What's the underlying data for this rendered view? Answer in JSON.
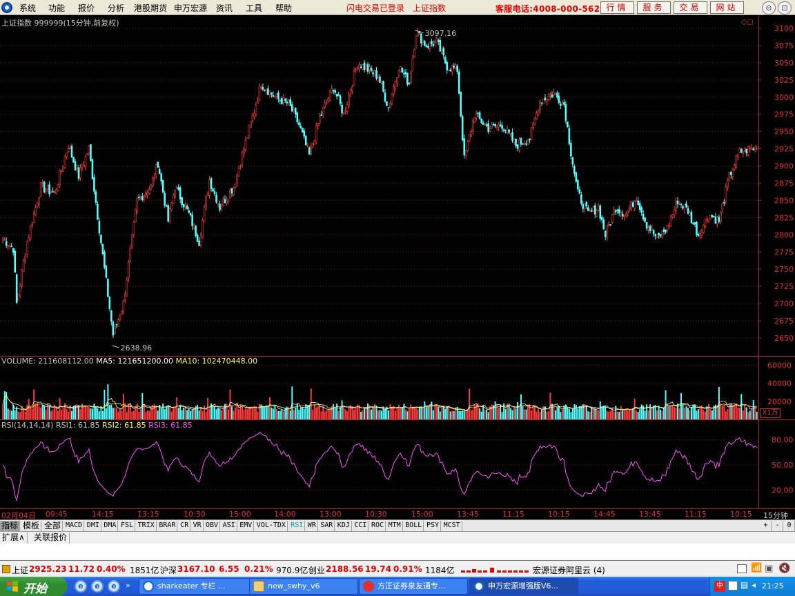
{
  "menu": [
    "系统",
    "功能",
    "报价",
    "分析",
    "港股期货",
    "申万宏源",
    "资讯",
    "工具",
    "帮助"
  ],
  "red_links": [
    "闪电交易已登录",
    "上证指数"
  ],
  "hotline": "客服电话:4008-000-562",
  "top_buttons": [
    "行情",
    "服务",
    "交易",
    "网站"
  ],
  "window_buttons": [
    "⊝",
    "⊡",
    "✕"
  ],
  "main_chart": {
    "title": "上证指数 999999(15分钟,前复权)",
    "high_label": "3097.16",
    "low_label": "2638.96",
    "y_ticks": [
      "3100",
      "3075",
      "3050",
      "3025",
      "3000",
      "2975",
      "2950",
      "2925",
      "2900",
      "2875",
      "2850",
      "2825",
      "2800",
      "2775",
      "2750",
      "2725",
      "2700",
      "2675",
      "2650"
    ],
    "corner_icons": "◇◻"
  },
  "volume_panel": {
    "label": "VOLUME: 211608112.00",
    "ma5": "MA5: 121651200.00",
    "ma10": "MA10: 102470448.00",
    "y_ticks": [
      "60000",
      "40000",
      "20000"
    ],
    "unit": "X1万"
  },
  "rsi_panel": {
    "label": "RSI(14,14,14)",
    "rsi1": "RSI1: 61.85",
    "rsi2": "RSI2: 61.85",
    "rsi3": "RSI3: 61.85",
    "y_ticks": [
      "80.00",
      "50.00",
      "20.00"
    ]
  },
  "time_axis": {
    "start": "02月04日",
    "labels": [
      "09:45",
      "14:15",
      "13:15",
      "10:30",
      "15:00",
      "14:00",
      "13:00",
      "10:30",
      "15:00",
      "13:45",
      "11:15",
      "10:15",
      "14:45",
      "13:45",
      "11:15",
      "10:15"
    ],
    "period": "15分钟"
  },
  "indicator_tabs": [
    "指标",
    "模板",
    "全部",
    "MACD",
    "DMI",
    "DMA",
    "FSL",
    "TRIX",
    "BRAR",
    "CR",
    "VR",
    "OBV",
    "ASI",
    "EMV",
    "VOL-TDX",
    "RSI",
    "WR",
    "SAR",
    "KDJ",
    "CCI",
    "ROC",
    "MTM",
    "BOLL",
    "PSY",
    "MCST"
  ],
  "tab_controls": [
    "+",
    "-",
    "0"
  ],
  "expand_buttons": [
    "扩展∧",
    "关联报价"
  ],
  "status": {
    "sh_name": "上证",
    "sh_price": "2925.23",
    "sh_change": "11.72",
    "sh_pct": "0.40%",
    "sh_amount": "1851亿",
    "hs_name": "沪深",
    "hs_price": "3167.10",
    "hs_change": "6.55",
    "hs_pct": "0.21%",
    "hs_amount": "970.9亿",
    "cy_name": "创业",
    "cy_price": "2188.56",
    "cy_change": "19.74",
    "cy_pct": "0.91%",
    "cy_amount": "1184亿",
    "broker": "宏源证券阿里云 (4)"
  },
  "taskbar": {
    "start": "开始",
    "tasks": [
      "sharkeater 专栏 ...",
      "new_swhy_v6",
      "方正证券泉友通专...",
      "申万宏源增强版V6..."
    ],
    "clock": "21:25"
  },
  "colors": {
    "up": "#ff3c3c",
    "down": "#54ffff",
    "grid": "#7a1010",
    "ma5": "#ffffff",
    "ma10": "#ffff40",
    "rsi": "#ff50ff"
  },
  "chart_data": {
    "type": "candlestick",
    "title": "上证指数 999999(15分钟,前复权)",
    "ylim": [
      2630,
      3110
    ],
    "high": 3097.16,
    "low": 2638.96,
    "close_path": [
      {
        "bar": 0,
        "price": 2795
      },
      {
        "bar": 6,
        "price": 2780
      },
      {
        "bar": 8,
        "price": 2700
      },
      {
        "bar": 14,
        "price": 2790
      },
      {
        "bar": 22,
        "price": 2870
      },
      {
        "bar": 30,
        "price": 2860
      },
      {
        "bar": 38,
        "price": 2930
      },
      {
        "bar": 44,
        "price": 2885
      },
      {
        "bar": 50,
        "price": 2925
      },
      {
        "bar": 58,
        "price": 2770
      },
      {
        "bar": 64,
        "price": 2655
      },
      {
        "bar": 70,
        "price": 2700
      },
      {
        "bar": 78,
        "price": 2850
      },
      {
        "bar": 86,
        "price": 2870
      },
      {
        "bar": 90,
        "price": 2905
      },
      {
        "bar": 96,
        "price": 2820
      },
      {
        "bar": 100,
        "price": 2870
      },
      {
        "bar": 108,
        "price": 2830
      },
      {
        "bar": 114,
        "price": 2790
      },
      {
        "bar": 120,
        "price": 2880
      },
      {
        "bar": 126,
        "price": 2840
      },
      {
        "bar": 134,
        "price": 2870
      },
      {
        "bar": 140,
        "price": 2925
      },
      {
        "bar": 146,
        "price": 2980
      },
      {
        "bar": 150,
        "price": 3020
      },
      {
        "bar": 158,
        "price": 3000
      },
      {
        "bar": 166,
        "price": 2990
      },
      {
        "bar": 172,
        "price": 2960
      },
      {
        "bar": 178,
        "price": 2915
      },
      {
        "bar": 184,
        "price": 2970
      },
      {
        "bar": 192,
        "price": 3015
      },
      {
        "bar": 198,
        "price": 2975
      },
      {
        "bar": 206,
        "price": 3050
      },
      {
        "bar": 212,
        "price": 3040
      },
      {
        "bar": 218,
        "price": 3030
      },
      {
        "bar": 224,
        "price": 2985
      },
      {
        "bar": 230,
        "price": 3045
      },
      {
        "bar": 236,
        "price": 3020
      },
      {
        "bar": 240,
        "price": 3095
      },
      {
        "bar": 246,
        "price": 3075
      },
      {
        "bar": 252,
        "price": 3080
      },
      {
        "bar": 258,
        "price": 3045
      },
      {
        "bar": 264,
        "price": 3040
      },
      {
        "bar": 268,
        "price": 2910
      },
      {
        "bar": 274,
        "price": 2975
      },
      {
        "bar": 282,
        "price": 2955
      },
      {
        "bar": 290,
        "price": 2960
      },
      {
        "bar": 298,
        "price": 2930
      },
      {
        "bar": 306,
        "price": 2940
      },
      {
        "bar": 312,
        "price": 2995
      },
      {
        "bar": 320,
        "price": 3005
      },
      {
        "bar": 326,
        "price": 2990
      },
      {
        "bar": 330,
        "price": 2920
      },
      {
        "bar": 334,
        "price": 2860
      },
      {
        "bar": 340,
        "price": 2830
      },
      {
        "bar": 346,
        "price": 2840
      },
      {
        "bar": 350,
        "price": 2800
      },
      {
        "bar": 356,
        "price": 2840
      },
      {
        "bar": 362,
        "price": 2830
      },
      {
        "bar": 368,
        "price": 2855
      },
      {
        "bar": 374,
        "price": 2815
      },
      {
        "bar": 380,
        "price": 2795
      },
      {
        "bar": 386,
        "price": 2810
      },
      {
        "bar": 392,
        "price": 2850
      },
      {
        "bar": 398,
        "price": 2835
      },
      {
        "bar": 404,
        "price": 2800
      },
      {
        "bar": 410,
        "price": 2830
      },
      {
        "bar": 416,
        "price": 2820
      },
      {
        "bar": 422,
        "price": 2885
      },
      {
        "bar": 428,
        "price": 2920
      },
      {
        "bar": 434,
        "price": 2925
      },
      {
        "bar": 438,
        "price": 2925
      }
    ],
    "volume_ylim": [
      0,
      65000
    ],
    "rsi_ylim": [
      0,
      100
    ]
  }
}
